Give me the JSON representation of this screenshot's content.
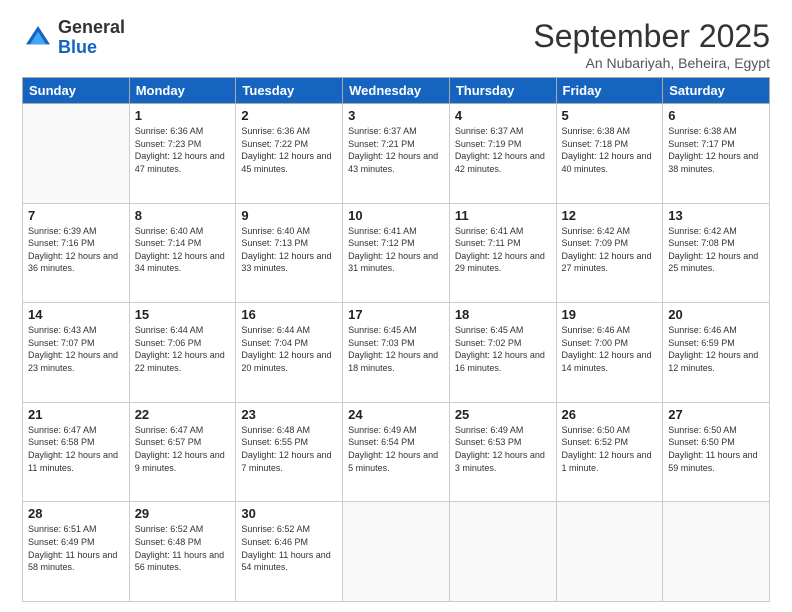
{
  "logo": {
    "general": "General",
    "blue": "Blue"
  },
  "title": "September 2025",
  "location": "An Nubariyah, Beheira, Egypt",
  "days_header": [
    "Sunday",
    "Monday",
    "Tuesday",
    "Wednesday",
    "Thursday",
    "Friday",
    "Saturday"
  ],
  "weeks": [
    [
      {
        "day": "",
        "sunrise": "",
        "sunset": "",
        "daylight": ""
      },
      {
        "day": "1",
        "sunrise": "Sunrise: 6:36 AM",
        "sunset": "Sunset: 7:23 PM",
        "daylight": "Daylight: 12 hours and 47 minutes."
      },
      {
        "day": "2",
        "sunrise": "Sunrise: 6:36 AM",
        "sunset": "Sunset: 7:22 PM",
        "daylight": "Daylight: 12 hours and 45 minutes."
      },
      {
        "day": "3",
        "sunrise": "Sunrise: 6:37 AM",
        "sunset": "Sunset: 7:21 PM",
        "daylight": "Daylight: 12 hours and 43 minutes."
      },
      {
        "day": "4",
        "sunrise": "Sunrise: 6:37 AM",
        "sunset": "Sunset: 7:19 PM",
        "daylight": "Daylight: 12 hours and 42 minutes."
      },
      {
        "day": "5",
        "sunrise": "Sunrise: 6:38 AM",
        "sunset": "Sunset: 7:18 PM",
        "daylight": "Daylight: 12 hours and 40 minutes."
      },
      {
        "day": "6",
        "sunrise": "Sunrise: 6:38 AM",
        "sunset": "Sunset: 7:17 PM",
        "daylight": "Daylight: 12 hours and 38 minutes."
      }
    ],
    [
      {
        "day": "7",
        "sunrise": "Sunrise: 6:39 AM",
        "sunset": "Sunset: 7:16 PM",
        "daylight": "Daylight: 12 hours and 36 minutes."
      },
      {
        "day": "8",
        "sunrise": "Sunrise: 6:40 AM",
        "sunset": "Sunset: 7:14 PM",
        "daylight": "Daylight: 12 hours and 34 minutes."
      },
      {
        "day": "9",
        "sunrise": "Sunrise: 6:40 AM",
        "sunset": "Sunset: 7:13 PM",
        "daylight": "Daylight: 12 hours and 33 minutes."
      },
      {
        "day": "10",
        "sunrise": "Sunrise: 6:41 AM",
        "sunset": "Sunset: 7:12 PM",
        "daylight": "Daylight: 12 hours and 31 minutes."
      },
      {
        "day": "11",
        "sunrise": "Sunrise: 6:41 AM",
        "sunset": "Sunset: 7:11 PM",
        "daylight": "Daylight: 12 hours and 29 minutes."
      },
      {
        "day": "12",
        "sunrise": "Sunrise: 6:42 AM",
        "sunset": "Sunset: 7:09 PM",
        "daylight": "Daylight: 12 hours and 27 minutes."
      },
      {
        "day": "13",
        "sunrise": "Sunrise: 6:42 AM",
        "sunset": "Sunset: 7:08 PM",
        "daylight": "Daylight: 12 hours and 25 minutes."
      }
    ],
    [
      {
        "day": "14",
        "sunrise": "Sunrise: 6:43 AM",
        "sunset": "Sunset: 7:07 PM",
        "daylight": "Daylight: 12 hours and 23 minutes."
      },
      {
        "day": "15",
        "sunrise": "Sunrise: 6:44 AM",
        "sunset": "Sunset: 7:06 PM",
        "daylight": "Daylight: 12 hours and 22 minutes."
      },
      {
        "day": "16",
        "sunrise": "Sunrise: 6:44 AM",
        "sunset": "Sunset: 7:04 PM",
        "daylight": "Daylight: 12 hours and 20 minutes."
      },
      {
        "day": "17",
        "sunrise": "Sunrise: 6:45 AM",
        "sunset": "Sunset: 7:03 PM",
        "daylight": "Daylight: 12 hours and 18 minutes."
      },
      {
        "day": "18",
        "sunrise": "Sunrise: 6:45 AM",
        "sunset": "Sunset: 7:02 PM",
        "daylight": "Daylight: 12 hours and 16 minutes."
      },
      {
        "day": "19",
        "sunrise": "Sunrise: 6:46 AM",
        "sunset": "Sunset: 7:00 PM",
        "daylight": "Daylight: 12 hours and 14 minutes."
      },
      {
        "day": "20",
        "sunrise": "Sunrise: 6:46 AM",
        "sunset": "Sunset: 6:59 PM",
        "daylight": "Daylight: 12 hours and 12 minutes."
      }
    ],
    [
      {
        "day": "21",
        "sunrise": "Sunrise: 6:47 AM",
        "sunset": "Sunset: 6:58 PM",
        "daylight": "Daylight: 12 hours and 11 minutes."
      },
      {
        "day": "22",
        "sunrise": "Sunrise: 6:47 AM",
        "sunset": "Sunset: 6:57 PM",
        "daylight": "Daylight: 12 hours and 9 minutes."
      },
      {
        "day": "23",
        "sunrise": "Sunrise: 6:48 AM",
        "sunset": "Sunset: 6:55 PM",
        "daylight": "Daylight: 12 hours and 7 minutes."
      },
      {
        "day": "24",
        "sunrise": "Sunrise: 6:49 AM",
        "sunset": "Sunset: 6:54 PM",
        "daylight": "Daylight: 12 hours and 5 minutes."
      },
      {
        "day": "25",
        "sunrise": "Sunrise: 6:49 AM",
        "sunset": "Sunset: 6:53 PM",
        "daylight": "Daylight: 12 hours and 3 minutes."
      },
      {
        "day": "26",
        "sunrise": "Sunrise: 6:50 AM",
        "sunset": "Sunset: 6:52 PM",
        "daylight": "Daylight: 12 hours and 1 minute."
      },
      {
        "day": "27",
        "sunrise": "Sunrise: 6:50 AM",
        "sunset": "Sunset: 6:50 PM",
        "daylight": "Daylight: 11 hours and 59 minutes."
      }
    ],
    [
      {
        "day": "28",
        "sunrise": "Sunrise: 6:51 AM",
        "sunset": "Sunset: 6:49 PM",
        "daylight": "Daylight: 11 hours and 58 minutes."
      },
      {
        "day": "29",
        "sunrise": "Sunrise: 6:52 AM",
        "sunset": "Sunset: 6:48 PM",
        "daylight": "Daylight: 11 hours and 56 minutes."
      },
      {
        "day": "30",
        "sunrise": "Sunrise: 6:52 AM",
        "sunset": "Sunset: 6:46 PM",
        "daylight": "Daylight: 11 hours and 54 minutes."
      },
      {
        "day": "",
        "sunrise": "",
        "sunset": "",
        "daylight": ""
      },
      {
        "day": "",
        "sunrise": "",
        "sunset": "",
        "daylight": ""
      },
      {
        "day": "",
        "sunrise": "",
        "sunset": "",
        "daylight": ""
      },
      {
        "day": "",
        "sunrise": "",
        "sunset": "",
        "daylight": ""
      }
    ]
  ]
}
